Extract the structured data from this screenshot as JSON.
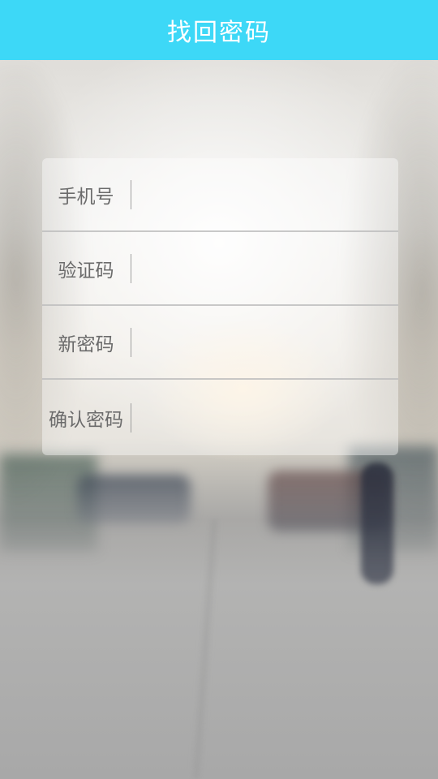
{
  "header": {
    "title": "找回密码"
  },
  "form": {
    "fields": [
      {
        "label": "手机号",
        "value": "",
        "placeholder": ""
      },
      {
        "label": "验证码",
        "value": "",
        "placeholder": ""
      },
      {
        "label": "新密码",
        "value": "",
        "placeholder": ""
      },
      {
        "label": "确认密码",
        "value": "",
        "placeholder": ""
      }
    ]
  },
  "colors": {
    "header_background": "#3dd8f7",
    "header_text": "#ffffff",
    "label_text": "#6b6b6b"
  }
}
